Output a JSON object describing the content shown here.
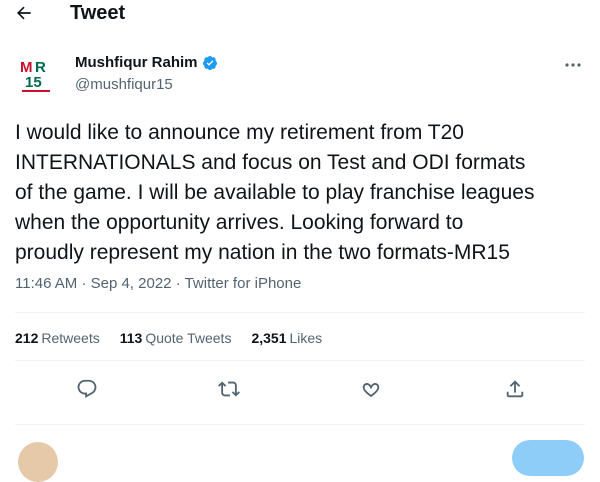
{
  "header": {
    "title": "Tweet"
  },
  "author": {
    "name": "Mushfiqur Rahim",
    "handle": "@mushfiqur15",
    "avatar_text": "MR15"
  },
  "tweet": {
    "text_lines": [
      "I would like to announce my retirement from T20",
      "INTERNATIONALS and focus on Test and ODI formats",
      "of the game. I will be available to play franchise leagues",
      "when the opportunity arrives. Looking forward to",
      "proudly represent my nation in the two formats-MR15"
    ],
    "time": "11:46 AM",
    "date": "Sep 4, 2022",
    "source": "Twitter for iPhone",
    "separator": "·"
  },
  "stats": {
    "retweets_count": "212",
    "retweets_label": "Retweets",
    "quotes_count": "113",
    "quotes_label": "Quote Tweets",
    "likes_count": "2,351",
    "likes_label": "Likes"
  },
  "icons": {
    "back": "arrow-left-icon",
    "more": "more-icon",
    "verified": "verified-badge-icon",
    "reply": "comment-icon",
    "retweet": "retweet-icon",
    "like": "heart-icon",
    "share": "share-icon"
  },
  "colors": {
    "text": "#0f1419",
    "secondary": "#536471",
    "verified": "#1d9bf0",
    "reply_button": "#8ecdf8",
    "divider": "#eff3f4"
  }
}
